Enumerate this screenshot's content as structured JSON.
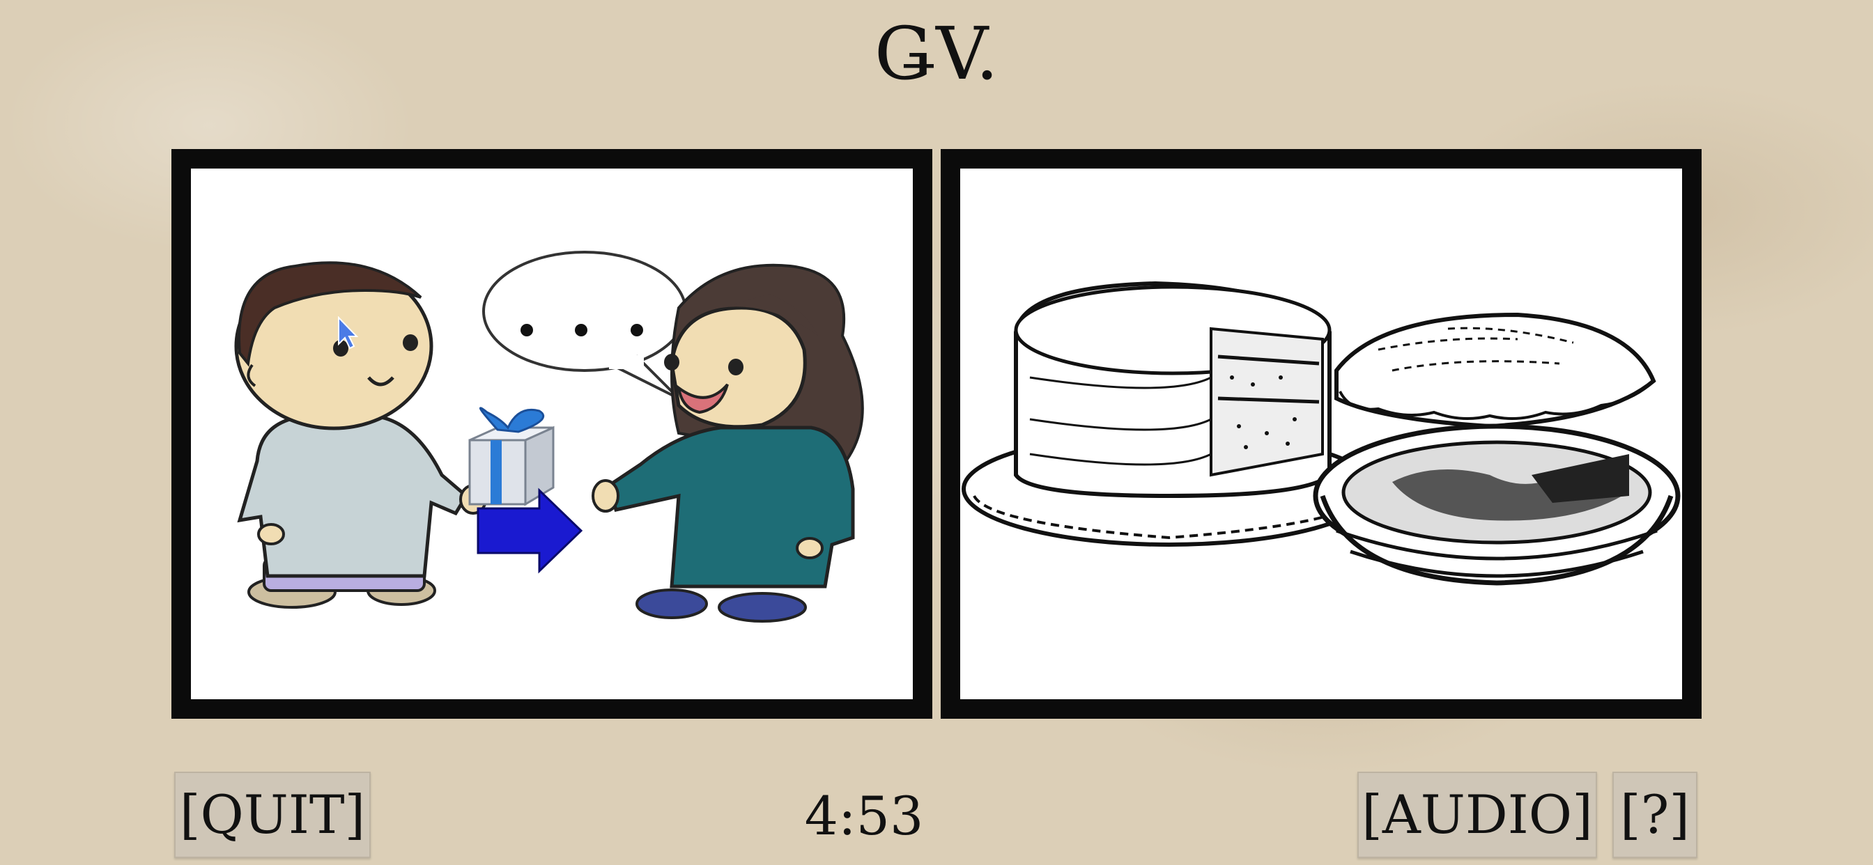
{
  "header": {
    "title": "ǤV."
  },
  "panels": [
    {
      "id": "left",
      "image": "person-giving-gift-illustration"
    },
    {
      "id": "right",
      "image": "cake-and-pies-illustration"
    }
  ],
  "speech_bubble": {
    "text": ". . ."
  },
  "controls": {
    "quit_label": "[QUIT]",
    "timer": "4:53",
    "audio_label": "[AUDIO]",
    "help_label": "[?]"
  },
  "colors": {
    "background": "#dccfb7",
    "panel_border": "#0b0b0b",
    "button_bg": "#cfc6b7",
    "arrow": "#1a1ad0"
  }
}
